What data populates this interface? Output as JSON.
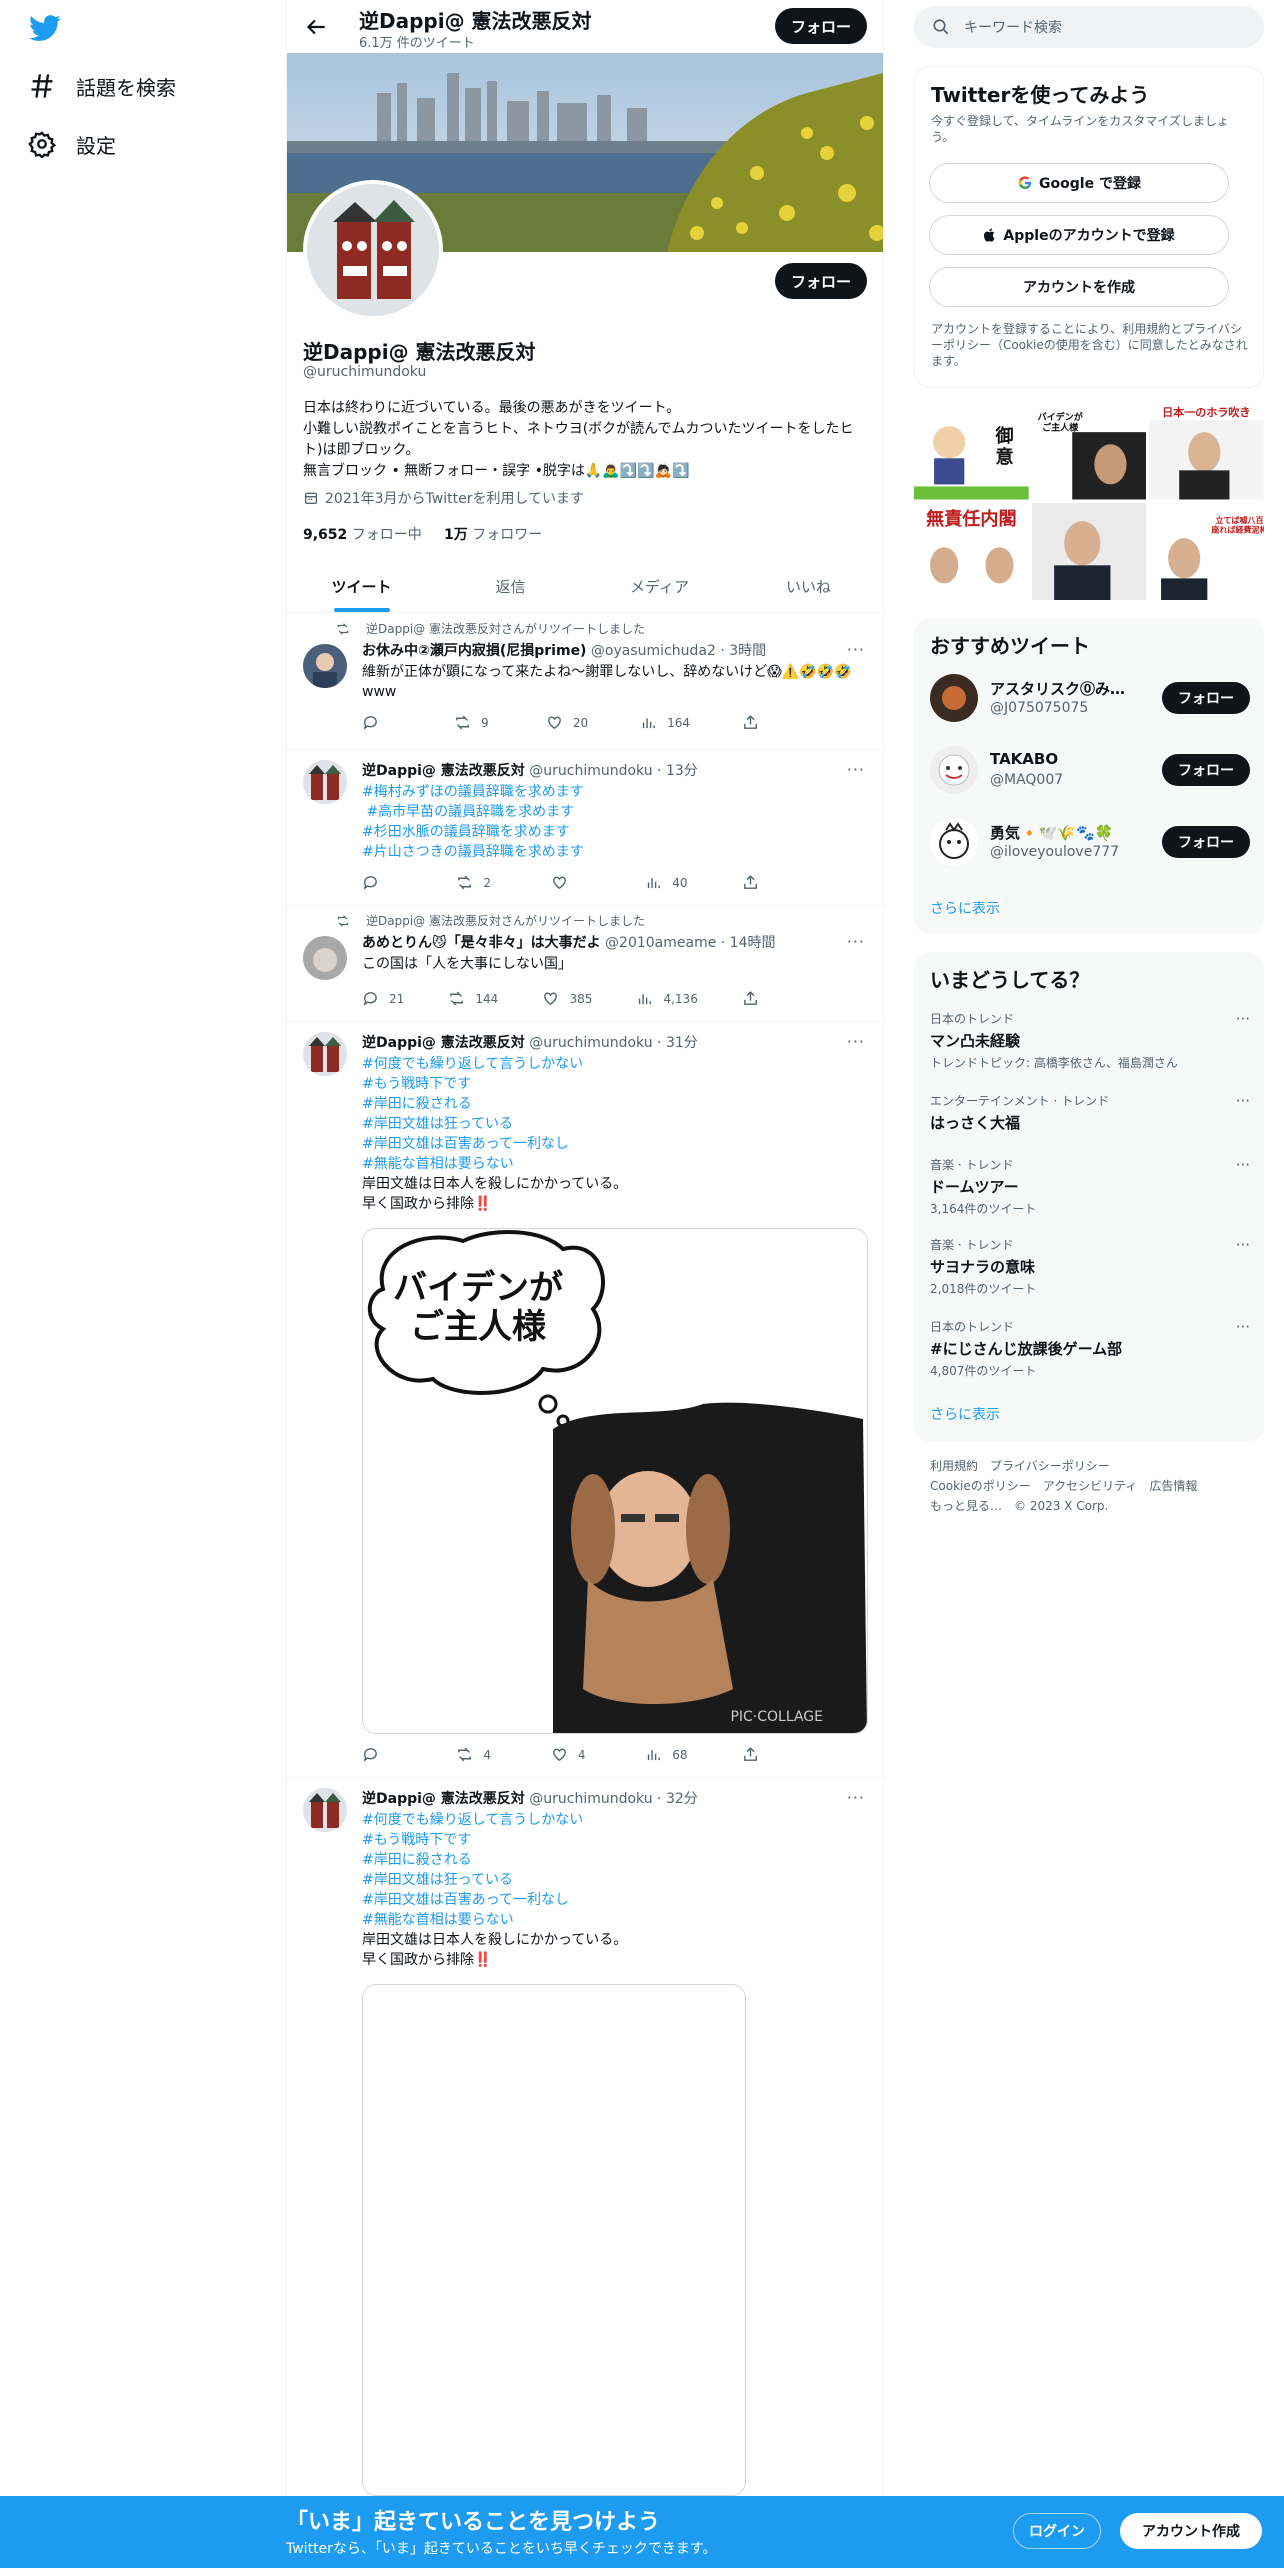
{
  "nav": {
    "search_label": "話題を検索",
    "settings_label": "設定"
  },
  "header": {
    "title": "逆Dappi@ 憲法改悪反対",
    "tweet_count": "6.1万 件のツイート",
    "follow_label": "フォロー"
  },
  "profile": {
    "name": "逆Dappi@ 憲法改悪反対",
    "handle": "@uruchimundoku",
    "bio": "日本は終わりに近づいている。最後の悪あがきをツイート。\n小難しい説教ポイことを言うヒト、ネトウヨ(ボクが読んでムカついたツイートをしたヒト)は即ブロック。\n無言ブロック • 無断フォロー・誤字 •脱字は🙏🙇‍♂️⤵️⤵️🙇🏻⤵️",
    "joined": "2021年3月からTwitterを利用しています",
    "following_count": "9,652",
    "following_label": "フォロー中",
    "followers_count": "1万",
    "followers_label": "フォロワー",
    "follow_label": "フォロー"
  },
  "tabs": [
    "ツイート",
    "返信",
    "メディア",
    "いいね"
  ],
  "tweets": [
    {
      "retweet_by": "逆Dappi@ 憲法改悪反対さんがリツイートしました",
      "author": "お休み中②瀬戸内寂損(尼損prime)",
      "handle": "@oyasumichuda2 · 3時間",
      "text": "維新が正体が顕になって来たよね～謝罪しないし、辞めないけど😱⚠️🤣🤣🤣www",
      "replies": "",
      "retweets": "9",
      "likes": "20",
      "views": "164"
    },
    {
      "author": "逆Dappi@ 憲法改悪反対",
      "handle": "@uruchimundoku · 13分",
      "tags": [
        "#梅村みずほの議員辞職を求めます",
        " #高市早苗の議員辞職を求めます",
        "#杉田水脈の議員辞職を求めます",
        "#片山さつきの議員辞職を求めます"
      ],
      "replies": "",
      "retweets": "2",
      "likes": "",
      "views": "40"
    },
    {
      "retweet_by": "逆Dappi@ 憲法改悪反対さんがリツイートしました",
      "author": "あめとりん😼「是々非々」は大事だよ",
      "handle": "@2010ameame · 14時間",
      "text": "この国は「人を大事にしない国」",
      "replies": "21",
      "retweets": "144",
      "likes": "385",
      "views": "4,136"
    },
    {
      "author": "逆Dappi@ 憲法改悪反対",
      "handle": "@uruchimundoku · 31分",
      "tags": [
        "#何度でも繰り返して言うしかない",
        "#もう戦時下です",
        "#岸田に殺される",
        "#岸田文雄は狂っている",
        "#岸田文雄は百害あって一利なし",
        "#無能な首相は要らない"
      ],
      "text": "岸田文雄は日本人を殺しにかかっている。\n早く国政から排除‼️",
      "image_text": "バイデンが\nご主人様",
      "image_watermark": "PIC·COLLAGE",
      "replies": "",
      "retweets": "4",
      "likes": "4",
      "views": "68"
    },
    {
      "author": "逆Dappi@ 憲法改悪反対",
      "handle": "@uruchimundoku · 32分",
      "tags": [
        "#何度でも繰り返して言うしかない",
        "#もう戦時下です",
        "#岸田に殺される",
        "#岸田文雄は狂っている",
        "#岸田文雄は百害あって一利なし",
        "#無能な首相は要らない"
      ],
      "text": "岸田文雄は日本人を殺しにかかっている。\n早く国政から排除‼️"
    }
  ],
  "right": {
    "search_placeholder": "キーワード検索",
    "signup": {
      "title": "Twitterを使ってみよう",
      "subtitle": "今すぐ登録して、タイムラインをカスタマイズしましょう。",
      "google": "Google で登録",
      "apple": "Appleのアカウントで登録",
      "create": "アカウントを作成",
      "terms": "アカウントを登録することにより、利用規約とプライバシーポリシー（Cookieの使用を含む）に同意したとみなされます。"
    },
    "grid_text": {
      "g1": "御\n意",
      "g2": "バイデンが\nご主人様",
      "g3": "日本一のホラ吹き",
      "g4": "無責任内閣",
      "g6": "立てば嘘八百\n座れば経費泥棒"
    },
    "recs_title": "おすすめツイート",
    "recs": [
      {
        "name": "アスタリスク⓪みんな…",
        "handle": "@J075075075",
        "follow": "フォロー"
      },
      {
        "name": "TAKABO",
        "handle": "@MAQ007",
        "follow": "フォロー"
      },
      {
        "name": "勇気🔸🕊️🌾🐾🍀",
        "handle": "@iloveyoulove777",
        "follow": "フォロー"
      }
    ],
    "show_more": "さらに表示",
    "trends_title": "いまどうしてる？",
    "trends": [
      {
        "cat": "日本のトレンド",
        "name": "マン凸未経験",
        "extra": "トレンドトピック: 高橋李依さん、福島潤さん"
      },
      {
        "cat": "エンターテインメント · トレンド",
        "name": "はっさく大福",
        "extra": ""
      },
      {
        "cat": "音楽 · トレンド",
        "name": "ドームツアー",
        "extra": "3,164件のツイート"
      },
      {
        "cat": "音楽 · トレンド",
        "name": "サヨナラの意味",
        "extra": "2,018件のツイート"
      },
      {
        "cat": "日本のトレンド",
        "name": "#にじさんじ放課後ゲーム部",
        "extra": "4,807件のツイート"
      }
    ],
    "footer": {
      "l1": "利用規約",
      "l2": "プライバシーポリシー",
      "l3": "Cookieのポリシー",
      "l4": "アクセシビリティ",
      "l5": "広告情報",
      "l6": "もっと見る…",
      "l7": "© 2023 X Corp."
    }
  },
  "bottom": {
    "title": "「いま」起きていることを見つけよう",
    "subtitle": "Twitterなら、「いま」起きていることをいち早くチェックできます。",
    "login": "ログイン",
    "signup": "アカウント作成"
  },
  "colors": {
    "accent": "#1d9bf0",
    "dark": "#0f1419",
    "muted": "#536471"
  }
}
